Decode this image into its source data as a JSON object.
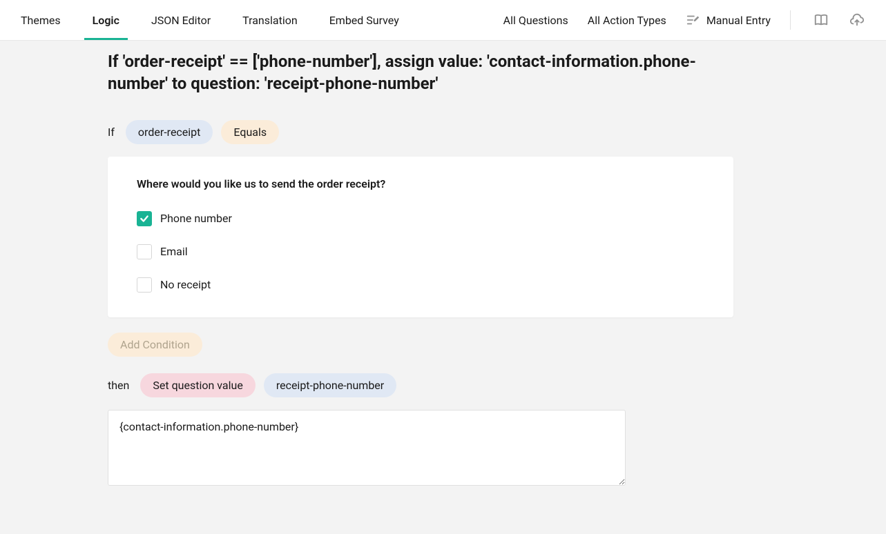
{
  "tabs": {
    "left": [
      {
        "label": "Themes",
        "active": false
      },
      {
        "label": "Logic",
        "active": true
      },
      {
        "label": "JSON Editor",
        "active": false
      },
      {
        "label": "Translation",
        "active": false
      },
      {
        "label": "Embed Survey",
        "active": false
      }
    ],
    "right": [
      {
        "label": "All Questions"
      },
      {
        "label": "All Action Types"
      },
      {
        "label": "Manual Entry",
        "icon": "manual-entry-icon"
      }
    ]
  },
  "rule": {
    "title": "If 'order-receipt' == ['phone-number'], assign value: 'contact-information.phone-number' to question: 'receipt-phone-number'"
  },
  "condition": {
    "if_keyword": "If",
    "question_pill": "order-receipt",
    "operator_pill": "Equals"
  },
  "question_preview": {
    "title": "Where would you like us to send the order receipt?",
    "options": [
      {
        "label": "Phone number",
        "checked": true
      },
      {
        "label": "Email",
        "checked": false
      },
      {
        "label": "No receipt",
        "checked": false
      }
    ]
  },
  "add_condition_label": "Add Condition",
  "action": {
    "then_keyword": "then",
    "type_pill": "Set question value",
    "target_pill": "receipt-phone-number",
    "value": "{contact-information.phone-number}"
  }
}
